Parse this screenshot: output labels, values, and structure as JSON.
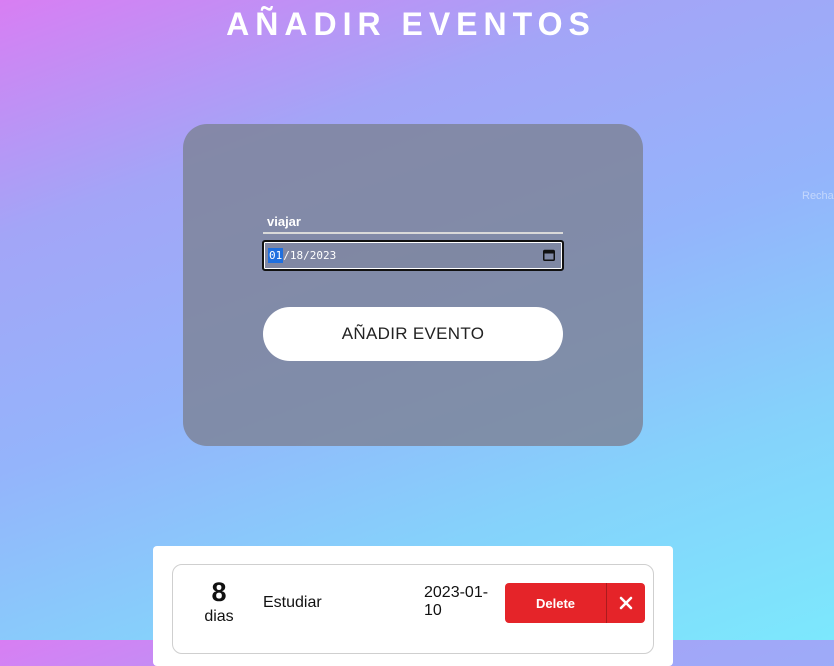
{
  "page": {
    "title": "AÑADIR EVENTOS",
    "side_hint": "Recha"
  },
  "form": {
    "event_name_value": "viajar",
    "date": {
      "month": "01",
      "day": "18",
      "year": "2023",
      "separator": "/"
    },
    "submit_label": "AÑADIR EVENTO",
    "calendar_icon": "calendar-icon"
  },
  "events": [
    {
      "days_count": "8",
      "days_unit": "dias",
      "name": "Estudiar",
      "date": "2023-01-10",
      "delete_label": "Delete",
      "delete_icon": "close-icon"
    }
  ],
  "colors": {
    "gradient_start": "#d87ef3",
    "gradient_end": "#7ce8fd",
    "card_bg": "#7d8296",
    "delete_red": "#e52429",
    "date_selection": "#1f6fdf"
  }
}
